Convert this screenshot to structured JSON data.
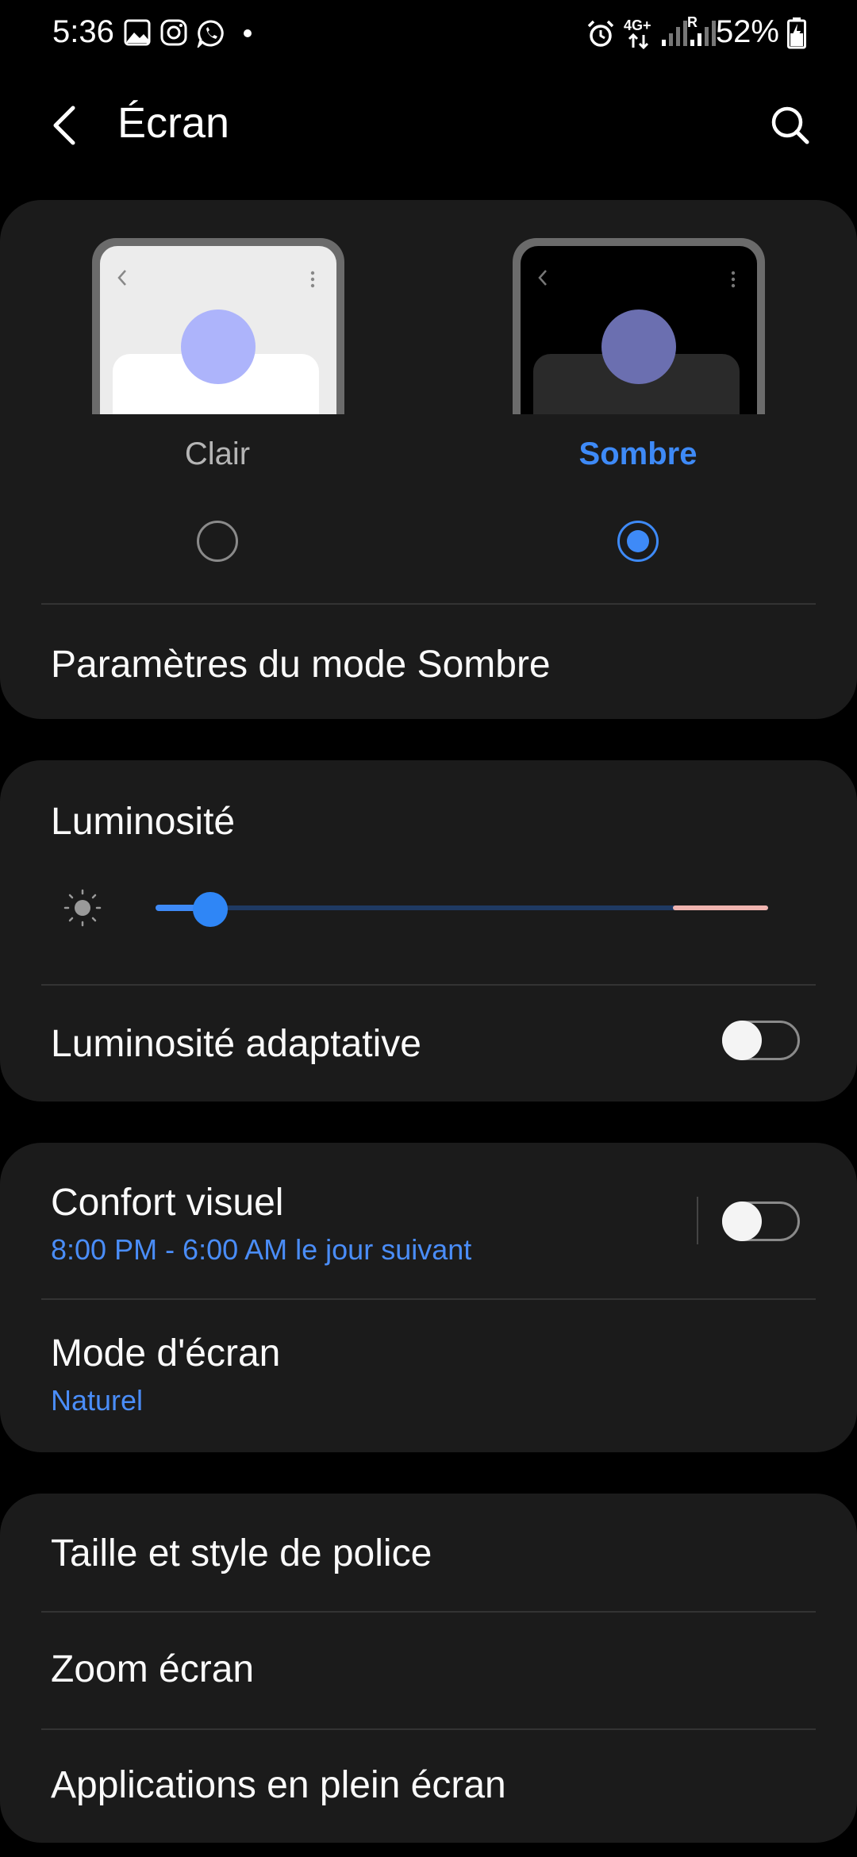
{
  "status_bar": {
    "time": "5:36",
    "network": "4G+",
    "roaming": "R",
    "battery": "52%",
    "icons": [
      "gallery-icon",
      "instagram-icon",
      "whatsapp-icon",
      "dot-icon",
      "alarm-icon",
      "signal-icon",
      "battery-charging-icon"
    ]
  },
  "header": {
    "title": "Écran"
  },
  "theme": {
    "options": [
      {
        "label": "Clair",
        "selected": false
      },
      {
        "label": "Sombre",
        "selected": true
      }
    ],
    "dark_mode_settings": "Paramètres du mode Sombre"
  },
  "brightness": {
    "title": "Luminosité",
    "level": 0.09,
    "adaptive_label": "Luminosité adaptative",
    "adaptive_on": false
  },
  "comfort": {
    "title": "Confort visuel",
    "schedule": "8:00 PM - 6:00 AM le jour suivant",
    "on": false,
    "screen_mode_title": "Mode d'écran",
    "screen_mode_value": "Naturel"
  },
  "font_section": {
    "items": [
      "Taille et style de police",
      "Zoom écran",
      "Applications en plein écran"
    ]
  },
  "colors": {
    "accent": "#3e8af7",
    "card": "#1b1b1b",
    "background": "#000000"
  }
}
